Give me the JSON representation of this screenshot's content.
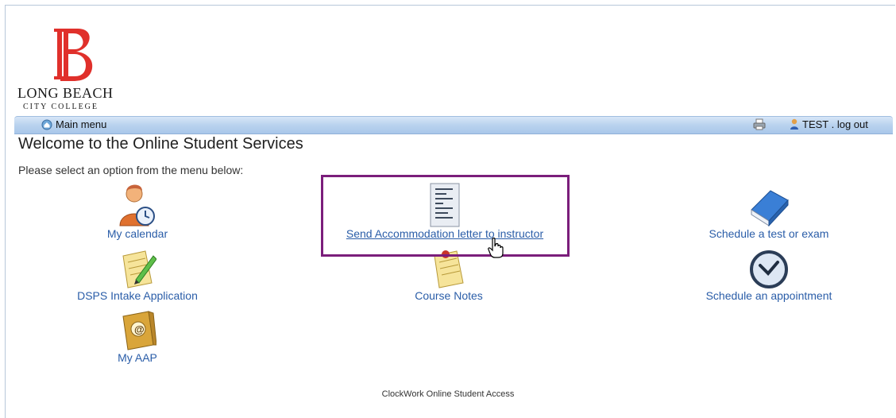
{
  "logo": {
    "line1": "LONG BEACH",
    "line2": "CITY COLLEGE",
    "brand_color": "#e0302b"
  },
  "menubar": {
    "main_menu_label": "Main menu",
    "user_label": "TEST . log out"
  },
  "page": {
    "title": "Welcome to the Online Student Services",
    "subtitle": "Please select an option from the menu below:"
  },
  "options": {
    "my_calendar": "My calendar",
    "send_letter": "Send Accommodation letter to instructor",
    "schedule_test": "Schedule a test or exam",
    "dsps_intake": "DSPS Intake Application",
    "course_notes": "Course Notes",
    "schedule_appointment": "Schedule an appointment",
    "my_aap": "My AAP"
  },
  "footer": {
    "text": "ClockWork Online Student Access"
  },
  "colors": {
    "link": "#2a5da8",
    "highlight_border": "#7b1e7b"
  }
}
